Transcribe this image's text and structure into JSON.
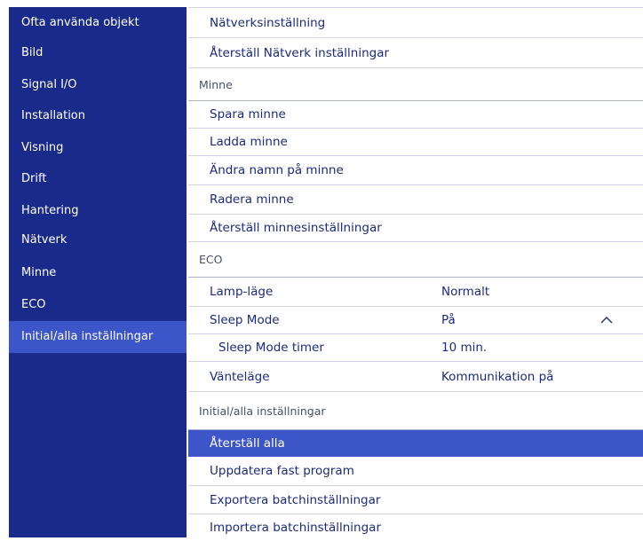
{
  "sidebar": {
    "items": [
      {
        "label": "Ofta använda objekt"
      },
      {
        "label": "Bild"
      },
      {
        "label": "Signal I/O"
      },
      {
        "label": "Installation"
      },
      {
        "label": "Visning"
      },
      {
        "label": "Drift"
      },
      {
        "label": "Hantering"
      },
      {
        "label": "Nätverk"
      },
      {
        "label": "Minne"
      },
      {
        "label": "ECO"
      },
      {
        "label": "Initial/alla inställningar",
        "active": true
      }
    ]
  },
  "main": {
    "network": {
      "setting": "Nätverksinställning",
      "reset": "Återställ Nätverk inställningar"
    },
    "memory": {
      "header": "Minne",
      "save": "Spara minne",
      "load": "Ladda minne",
      "rename": "Ändra namn på minne",
      "erase": "Radera minne",
      "reset": "Återställ minnesinställningar"
    },
    "eco": {
      "header": "ECO",
      "lamp_mode_label": "Lamp-läge",
      "lamp_mode_value": "Normalt",
      "sleep_mode_label": "Sleep Mode",
      "sleep_mode_value": "På",
      "sleep_timer_label": "Sleep Mode timer",
      "sleep_timer_value": "10 min.",
      "standby_label": "Vänteläge",
      "standby_value": "Kommunikation på"
    },
    "initial": {
      "header": "Initial/alla inställningar",
      "reset_all": "Återställ alla",
      "update_firmware": "Uppdatera fast program",
      "export_batch": "Exportera batchinställningar",
      "import_batch": "Importera batchinställningar"
    }
  },
  "colors": {
    "sidebar_bg": "#1a2a8a",
    "accent": "#3c55c9",
    "text": "#1b2a80"
  },
  "icons": {
    "collapse": "chevron-up-icon"
  }
}
